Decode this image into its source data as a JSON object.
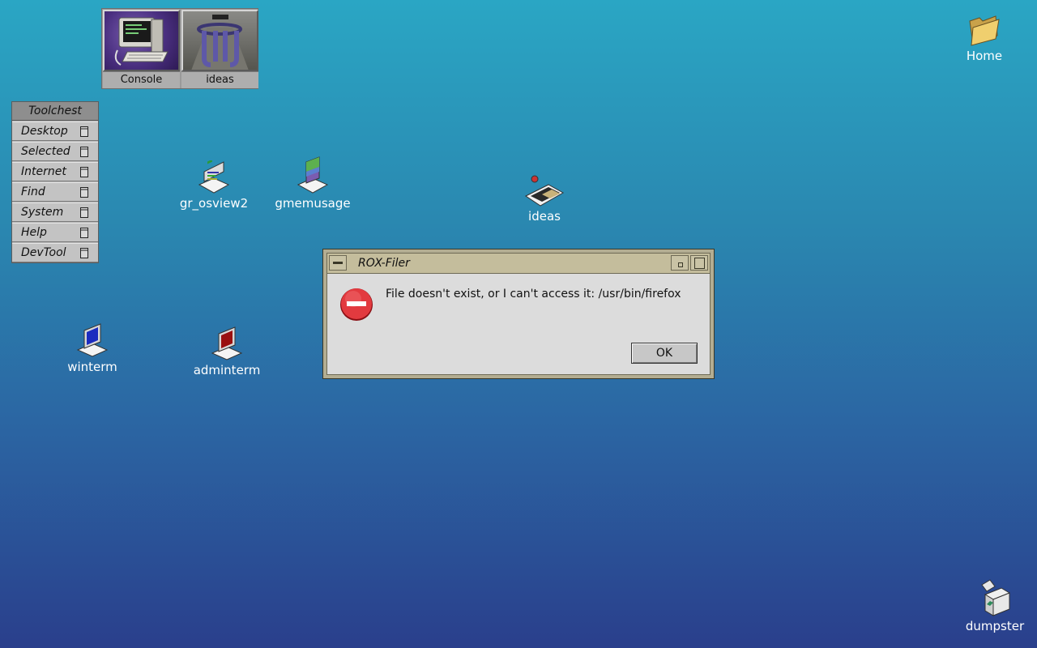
{
  "launcher": {
    "items": [
      {
        "label": "Console",
        "icon": "console-computer-icon"
      },
      {
        "label": "ideas",
        "icon": "ideas-logo-icon"
      }
    ]
  },
  "toolchest": {
    "title": "Toolchest",
    "items": [
      {
        "label": "Desktop"
      },
      {
        "label": "Selected"
      },
      {
        "label": "Internet"
      },
      {
        "label": "Find"
      },
      {
        "label": "System"
      },
      {
        "label": "Help"
      },
      {
        "label": "DevTool"
      }
    ]
  },
  "desktop": {
    "icons": {
      "gr_osview2": "gr_osview2",
      "gmemusage": "gmemusage",
      "ideas": "ideas",
      "winterm": "winterm",
      "adminterm": "adminterm",
      "home": "Home",
      "dumpster": "dumpster"
    }
  },
  "dialog": {
    "title": "ROX-Filer",
    "message": "File doesn't exist, or I can't access it: /usr/bin/firefox",
    "ok_label": "OK",
    "icon": "error-stop-icon"
  },
  "colors": {
    "desktop_top": "#2aa6c4",
    "desktop_bottom": "#2a3f8c",
    "dialog_frame": "#b3ad92",
    "error_red": "#d9232b"
  }
}
